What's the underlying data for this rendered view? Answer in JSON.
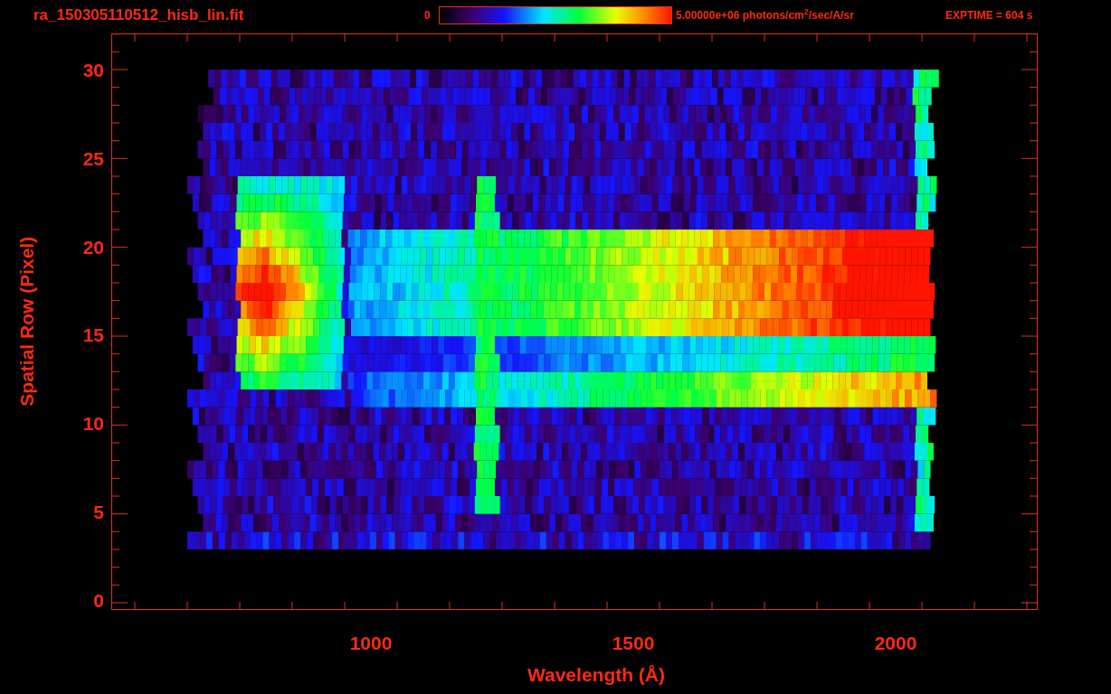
{
  "header": {
    "filename": "ra_150305110512_hisb_lin.fit",
    "colorbar": {
      "min_label": "0",
      "max_label": "5.00000e+06 photons/cm$^{2}$/sec/A/sr"
    },
    "exposure": "EXPTIME = 604 s"
  },
  "y_axis": {
    "label": "Spatial Row (Pixel)",
    "ticks": [
      "30",
      "25",
      "20",
      "15",
      "10",
      "5",
      "0"
    ]
  },
  "x_axis": {
    "label": "Wavelength (Å)",
    "ticks": [
      "1000",
      "1500",
      "2000"
    ]
  }
}
